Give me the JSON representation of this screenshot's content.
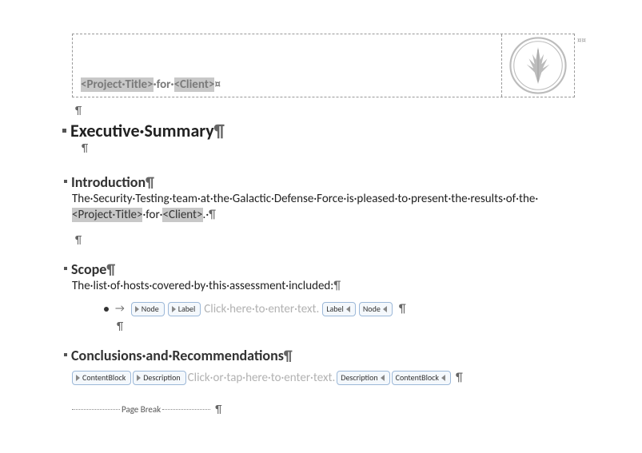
{
  "header": {
    "field_project_title": "<Project·Title>",
    "for_text": "·for·",
    "field_client": "<Client>",
    "end_mark": "¤",
    "tail_mark": "¤¤"
  },
  "marks": {
    "pilcrow": "¶",
    "arrow": "→"
  },
  "headings": {
    "exec_summary": "Executive·Summary",
    "introduction": "Introduction",
    "scope": "Scope",
    "conclusions": "Conclusions·and·Recommendations"
  },
  "body": {
    "intro_pre": "The·Security·Testing·team·at·the·Galactic·Defense·Force·is·pleased·to·present·the·results·of·the·",
    "intro_field1": "<Project·Title>",
    "intro_mid": "·for·",
    "intro_field2": "<Client>",
    "intro_end": ".·",
    "scope_text": "The·list·of·hosts·covered·by·this·assessment·included:"
  },
  "content_controls": {
    "node": "Node",
    "label": "Label",
    "contentblock": "ContentBlock",
    "description": "Description",
    "placeholder1": "Click·here·to·enter·text.",
    "placeholder2": "Click·or·tap·here·to·enter·text."
  },
  "page_break": {
    "label": "Page Break"
  }
}
